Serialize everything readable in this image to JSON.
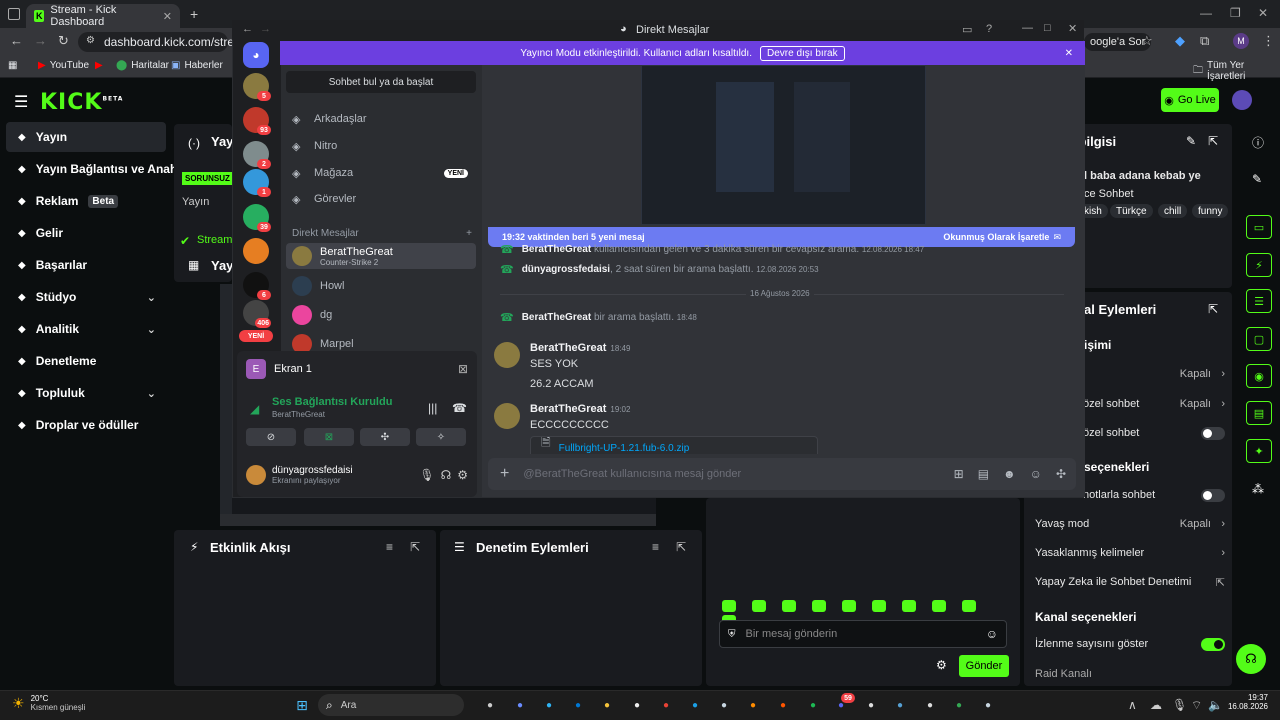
{
  "browser": {
    "tab_title": "Stream - Kick Dashboard",
    "url": "dashboard.kick.com/stream",
    "search_chip": "oogle'a Sor",
    "bookmarks": [
      "YouTube",
      "Haritalar",
      "Haberler"
    ],
    "all_bookmarks": "Tüm Yer İşaretleri",
    "profile_initial": "M"
  },
  "kick": {
    "logo": "KICK",
    "logo_badge": "BETA",
    "go_live": "Go Live",
    "sidebar": [
      {
        "label": "Yayın",
        "icon": "stream-icon"
      },
      {
        "label": "Yayın Bağlantısı ve Anahtar",
        "icon": "link-icon"
      },
      {
        "label": "Reklam",
        "icon": "ad-icon",
        "badge": "Beta"
      },
      {
        "label": "Gelir",
        "icon": "revenue-icon"
      },
      {
        "label": "Başarılar",
        "icon": "trophy-icon"
      },
      {
        "label": "Stüdyo",
        "icon": "studio-icon",
        "expandable": true
      },
      {
        "label": "Analitik",
        "icon": "analytics-icon",
        "expandable": true
      },
      {
        "label": "Denetleme",
        "icon": "hammer-icon"
      },
      {
        "label": "Topluluk",
        "icon": "community-icon",
        "expandable": true
      },
      {
        "label": "Droplar ve ödüller",
        "icon": "gift-icon"
      }
    ],
    "stream_panel": {
      "title": "Yay",
      "status_badge": "SORUNSUZ",
      "label": "Yayın",
      "stream_status": "Stream",
      "second_title": "Yay"
    },
    "info_panel": {
      "title": "n bilgisi",
      "stream_title": "l baba adana kebab ye",
      "category": "ce Sohbet",
      "tags": [
        "kish",
        "Türkçe",
        "chill",
        "funny"
      ]
    },
    "mod_panel": {
      "title": "al Eylemleri",
      "section1": "işimi",
      "rows": [
        {
          "label": "",
          "value": "Kapalı",
          "type": "link"
        },
        {
          "label": "özel sohbet",
          "value": "Kapalı",
          "type": "link"
        },
        {
          "label": "özel sohbet",
          "type": "toggle",
          "on": false
        }
      ],
      "section2": "seçenekleri",
      "rows2": [
        {
          "label": "notlarla sohbet",
          "type": "toggle",
          "on": false
        },
        {
          "label": "Yavaş mod",
          "value": "Kapalı",
          "type": "link"
        },
        {
          "label": "Yasaklanmış kelimeler",
          "type": "link"
        },
        {
          "label": "Yapay Zeka ile Sohbet Denetimi",
          "type": "external"
        }
      ],
      "section3": "Kanal seçenekleri",
      "rows3": [
        {
          "label": "İzlenme sayısını göster",
          "type": "toggle",
          "on": true
        },
        {
          "label": "Raid Kanalı",
          "type": "text"
        }
      ]
    },
    "activity_panel": {
      "title": "Etkinlik Akışı"
    },
    "moderation_panel": {
      "title": "Denetim Eylemleri"
    },
    "chat": {
      "placeholder": "Bir mesaj gönderin",
      "send": "Gönder"
    }
  },
  "discord": {
    "window_title": "Direkt Mesajlar",
    "banner_text": "Yayıncı Modu etkinleştirildi. Kullanıcı adları kısaltıldı.",
    "banner_button": "Devre dışı bırak",
    "search": "Sohbet bul ya da başlat",
    "nav": [
      {
        "label": "Arkadaşlar",
        "icon": "friends-icon"
      },
      {
        "label": "Nitro",
        "icon": "nitro-icon"
      },
      {
        "label": "Mağaza",
        "icon": "shop-icon",
        "badge": "YENİ"
      },
      {
        "label": "Görevler",
        "icon": "quests-icon"
      }
    ],
    "dm_header": "Direkt Mesajlar",
    "dms": [
      {
        "name": "BeratTheGreat",
        "status": "Counter-Strike 2",
        "selected": true
      },
      {
        "name": "Howl",
        "status": ""
      },
      {
        "name": "dg",
        "status": ""
      },
      {
        "name": "Marpel",
        "status": ""
      }
    ],
    "guild_badges": [
      "5",
      "93",
      "2",
      "1",
      "39",
      "",
      "6",
      "406"
    ],
    "new_badge": "YENİ",
    "screen_share": "Ekran 1",
    "voice_status": "Ses Bağlantısı Kuruldu",
    "voice_user": "BeratTheGreat",
    "me": {
      "name": "dünyagrossfedaisi",
      "status": "Ekranını paylaşıyor"
    },
    "new_messages_bar": "19:32 vaktinden beri 5 yeni mesaj",
    "mark_read": "Okunmuş Olarak İşaretle",
    "messages": [
      {
        "type": "system",
        "name": "BeratTheGreat",
        "text": "kullanıcısından gelen ve 3 dakika süren bir cevapsız arama.",
        "time": "12.08.2026 18:47"
      },
      {
        "type": "system",
        "name": "dünyagrossfedaisi",
        "text": ", 2 saat süren bir arama başlattı.",
        "time": "12.08.2026 20:53"
      },
      {
        "type": "divider",
        "text": "16 Ağustos 2026"
      },
      {
        "type": "system",
        "name": "BeratTheGreat",
        "text": "bir arama başlattı.",
        "time": "18:48"
      },
      {
        "type": "user",
        "name": "BeratTheGreat",
        "time": "18:49",
        "lines": [
          "SES YOK",
          "26.2 ACCAM"
        ]
      },
      {
        "type": "user",
        "name": "BeratTheGreat",
        "time": "19:02",
        "lines": [
          "ECCCCCCCCC"
        ]
      }
    ],
    "attachment": "Fullbright-UP-1.21.fub-6.0.zip",
    "input_placeholder": "@BeratTheGreat kullanıcısına mesaj gönder"
  },
  "taskbar": {
    "weather_temp": "20°C",
    "weather_text": "Kısmen güneşli",
    "search": "Ara",
    "time": "19:37",
    "date": "16.08.2026",
    "discord_badge": "59"
  }
}
